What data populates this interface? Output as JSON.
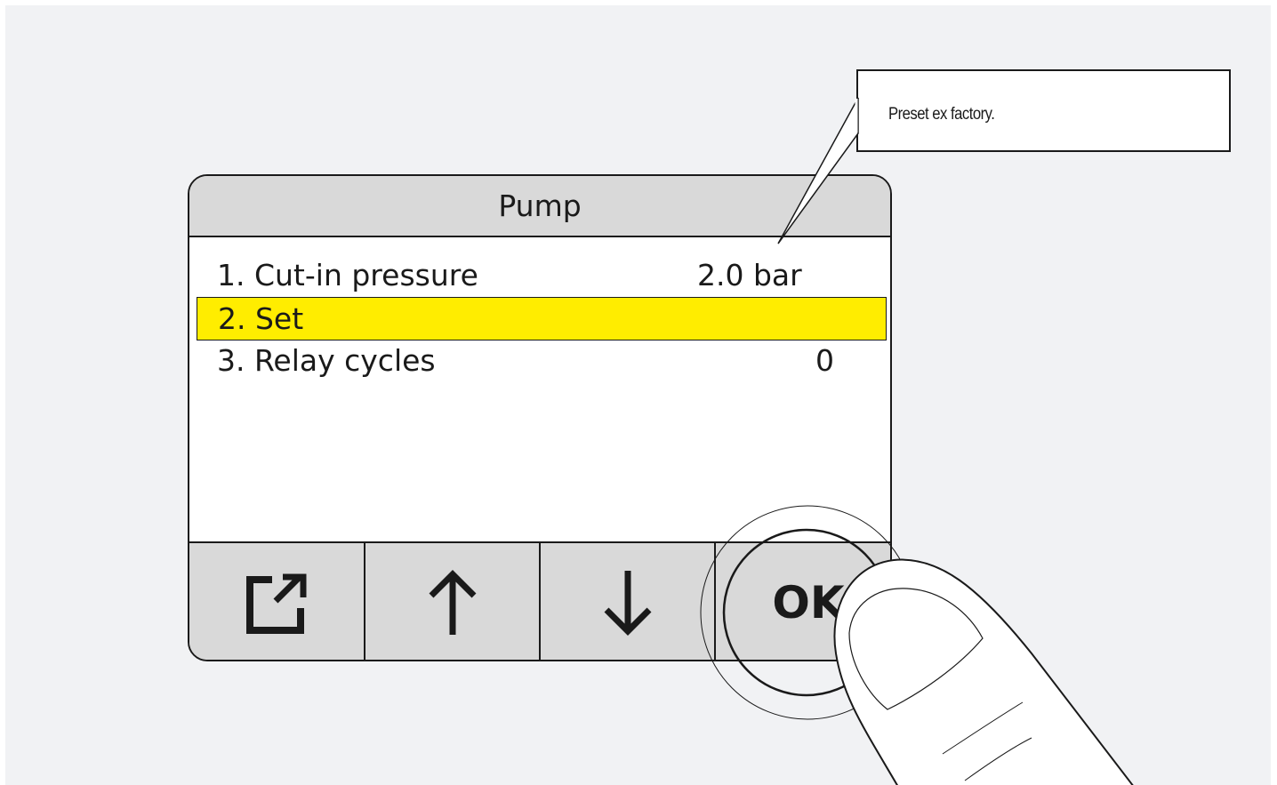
{
  "screen": {
    "title": "Pump",
    "menu_items": [
      {
        "label": "1. Cut-in pressure",
        "value": "2.0 bar",
        "selected": false
      },
      {
        "label": "2. Set",
        "value": "",
        "selected": true
      },
      {
        "label": "3. Relay cycles",
        "value": "0",
        "selected": false
      }
    ]
  },
  "buttons": {
    "exit_icon": "external-exit-icon",
    "up_icon": "arrow-up-icon",
    "down_icon": "arrow-down-icon",
    "ok_label": "OK"
  },
  "callout": {
    "text": "Preset ex factory."
  },
  "colors": {
    "highlight": "#ffed00",
    "panel": "#d9d9d9",
    "background": "#f1f2f4",
    "outline": "#1a1a1a"
  }
}
